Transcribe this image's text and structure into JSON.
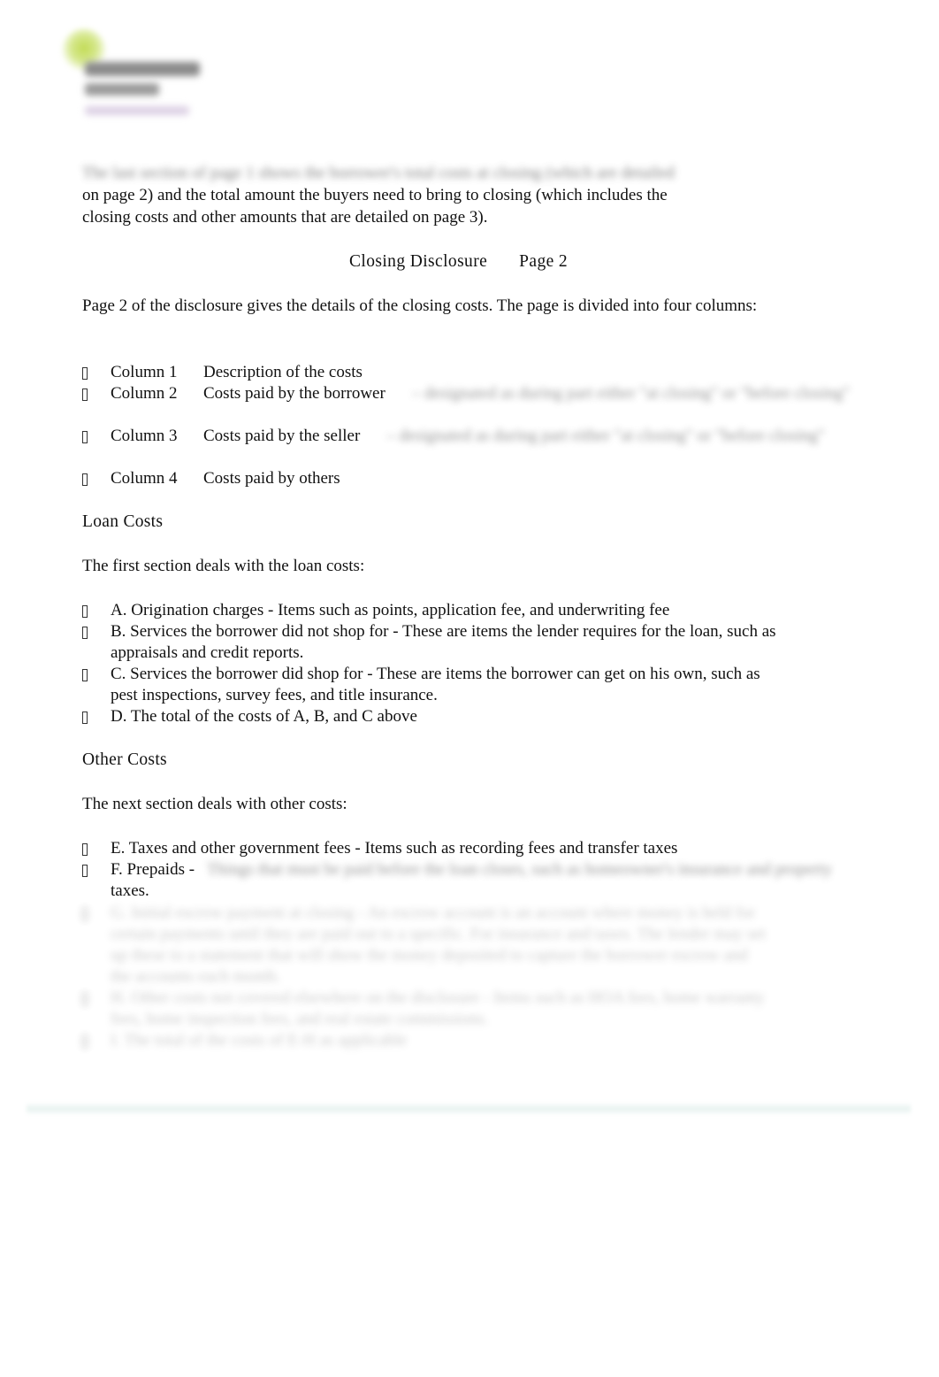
{
  "logo": {
    "icon": "leaf-logo-icon",
    "brand_color": "#c2db55",
    "name_line_1": "McKissock",
    "name_line_2": "Learning",
    "tagline": "A Colibri Group Company"
  },
  "intro": {
    "blurred_line": "The last section of page 1 shows the borrower's total costs at closing (which are detailed",
    "lines": [
      "on page 2) and the total amount the buyers need to bring to closing (which includes the",
      "closing costs and other amounts that are detailed on page 3)."
    ]
  },
  "section_title": {
    "left": "Closing Disclosure",
    "separator": "–",
    "right": "Page 2"
  },
  "page2_intro": "Page 2 of the disclosure gives the details of the closing costs. The page is divided into four columns:",
  "columns": [
    {
      "name": "Column 1",
      "description": "Description of the costs",
      "note": ""
    },
    {
      "name": "Column 2",
      "description": "Costs paid by the borrower",
      "note": "– designated as during part either \"at closing\" or \"before closing\""
    },
    {
      "name": "Column 3",
      "description": "Costs paid by the seller",
      "note": "– designated as during part either \"at closing\" or \"before closing\""
    },
    {
      "name": "Column 4",
      "description": "Costs paid by others",
      "note": ""
    }
  ],
  "loan_costs": {
    "heading": "Loan Costs",
    "intro": "The first section deals with the loan costs:",
    "items": [
      "A. Origination charges - Items such as points, application fee, and underwriting fee",
      "B. Services the borrower did not shop for - These are items the lender requires for the loan, such as appraisals and credit reports.",
      "C. Services the borrower did shop for - These are items the borrower can get on his own, such as pest inspections, survey fees, and title insurance.",
      "D. The total of the costs of A, B, and C above"
    ]
  },
  "other_costs": {
    "heading": "Other Costs",
    "intro": "The next section deals with other costs:",
    "items": [
      {
        "text": "E. Taxes and other government fees - Items such as recording fees and transfer taxes",
        "blurred_tail": ""
      },
      {
        "text": "F. Prepaids -",
        "blurred_tail": "Things that must be paid before the loan closes, such as homeowner's insurance and property",
        "continuation": "taxes."
      }
    ],
    "blurred_items": [
      "G. Initial escrow payment at closing - An escrow account is an account where money is held for certain payments until they are paid out to a specific. For insurance and taxes. The lender may set up these to a statement that will show the money deposited to capture the borrower escrow and the accounts each month.",
      "H. Other costs not covered elsewhere on the disclosure - Items such as HOA fees, home warranty fees, home inspection fees, and real estate commissions.",
      "I. The total of the costs of E-H as applicable"
    ]
  },
  "bullet_glyph": ""
}
